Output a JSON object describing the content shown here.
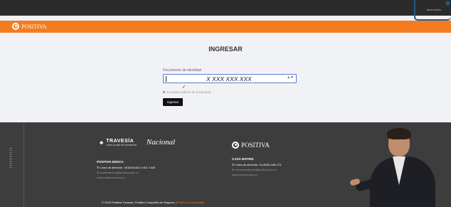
{
  "topbar": {
    "link": "Iniciar sesión"
  },
  "header": {
    "brand": "POSITIVA"
  },
  "login": {
    "title": "INGRESAR",
    "doc_label": "Documento de identidad",
    "doc_value": "X XXX XXX XXX",
    "stepper": "▲▼",
    "terms": "Si acepto política de privacidad",
    "submit": "Ingresar"
  },
  "footer": {
    "brand_travesia": "TRAVESÍA",
    "brand_travesia_sub": "vuelo al sello de excelencia",
    "brand_nacional": "Nacional",
    "brand_positiva": "POSITIVA",
    "educa": {
      "title": "POSITIVA EDUCA",
      "line1": "Línea de atención: 3016244152 o 601 7158",
      "line2": "positivaeduca@positiva.gov.co",
      "line3": "www.positivaeduca.co"
    },
    "matriz": {
      "title": "CASA MATRIZ",
      "line1": "Línea de atención: 01-8000-180-170",
      "line2": "servicioalcliente@positiva.gov.co",
      "line3": "www.positiva.gov.co"
    },
    "copyright": "© 2019 Positiva Travesía, Positiva Compañía de Seguros. |",
    "privacy": "Política de privacidad"
  }
}
